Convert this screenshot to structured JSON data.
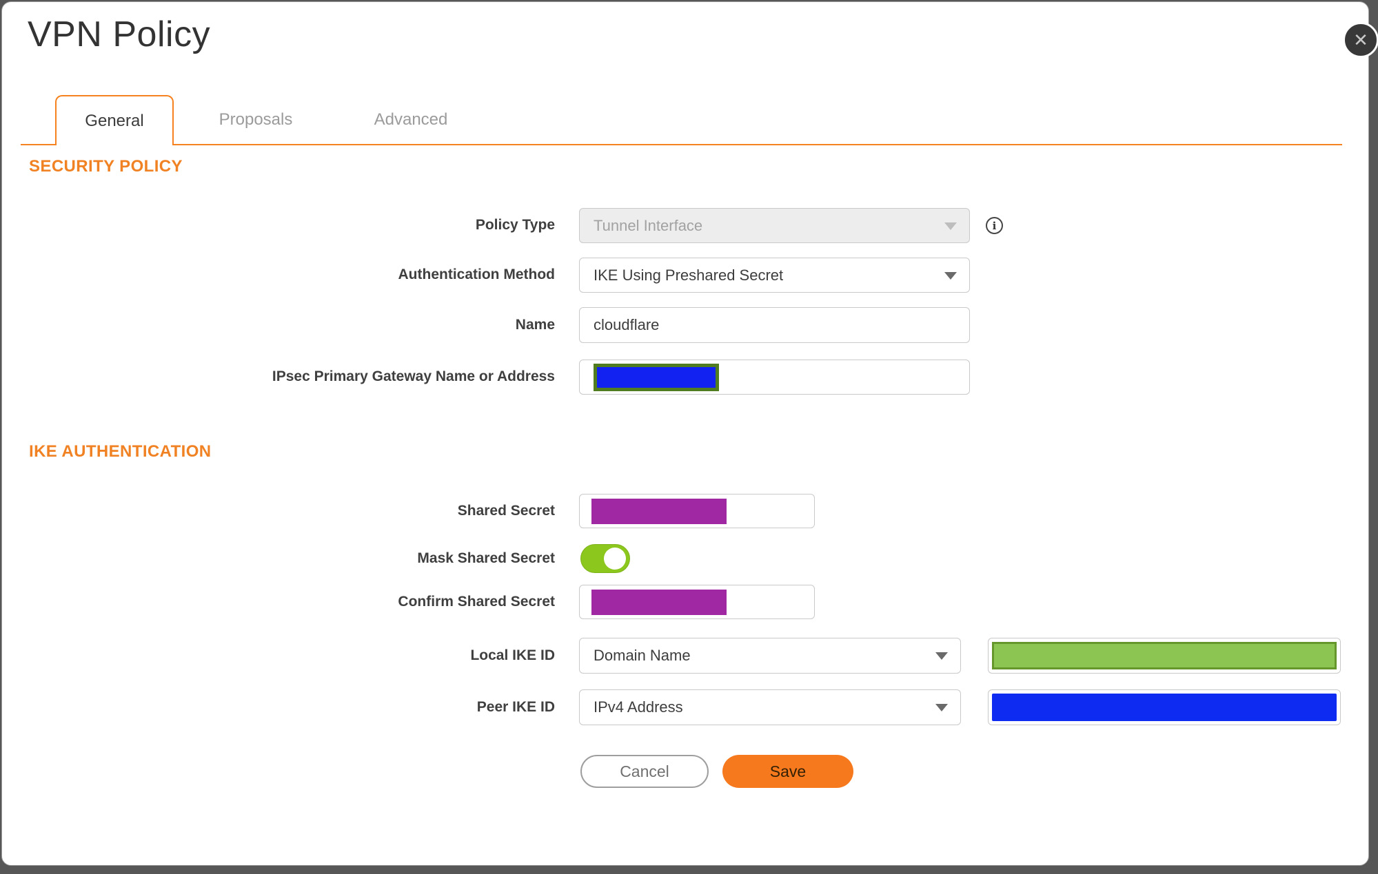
{
  "dialog": {
    "title": "VPN Policy"
  },
  "icons": {
    "close": "✕",
    "info": "i"
  },
  "tabs": [
    {
      "label": "General",
      "active": true
    },
    {
      "label": "Proposals",
      "active": false
    },
    {
      "label": "Advanced",
      "active": false
    }
  ],
  "sections": {
    "security_policy": "SECURITY POLICY",
    "ike_authentication": "IKE AUTHENTICATION"
  },
  "fields": {
    "policy_type": {
      "label": "Policy Type",
      "value": "Tunnel Interface",
      "disabled": true
    },
    "authentication_method": {
      "label": "Authentication Method",
      "value": "IKE Using Preshared Secret"
    },
    "name": {
      "label": "Name",
      "value": "cloudflare"
    },
    "gateway": {
      "label": "IPsec Primary Gateway Name or Address",
      "value_redacted": true
    },
    "shared_secret": {
      "label": "Shared Secret",
      "value_redacted": true
    },
    "mask_shared_secret": {
      "label": "Mask Shared Secret",
      "state": "on"
    },
    "confirm_shared_secret": {
      "label": "Confirm Shared Secret",
      "value_redacted": true
    },
    "local_ike_id": {
      "label": "Local IKE ID",
      "value": "Domain Name",
      "id_value_redacted": true
    },
    "peer_ike_id": {
      "label": "Peer IKE ID",
      "value": "IPv4 Address",
      "id_value_redacted": true
    }
  },
  "buttons": {
    "cancel": "Cancel",
    "save": "Save"
  },
  "colors": {
    "accent_orange": "#F6821F",
    "section_header_orange": "#F08223",
    "redaction_blue": "#1222F0",
    "redaction_purple": "#A128A3",
    "redaction_green_fill": "#8DC553",
    "redaction_green_border": "#66972C",
    "gateway_redaction_border": "#517C20",
    "toggle_on_green": "#8CC71E",
    "page_background": "#575757"
  }
}
